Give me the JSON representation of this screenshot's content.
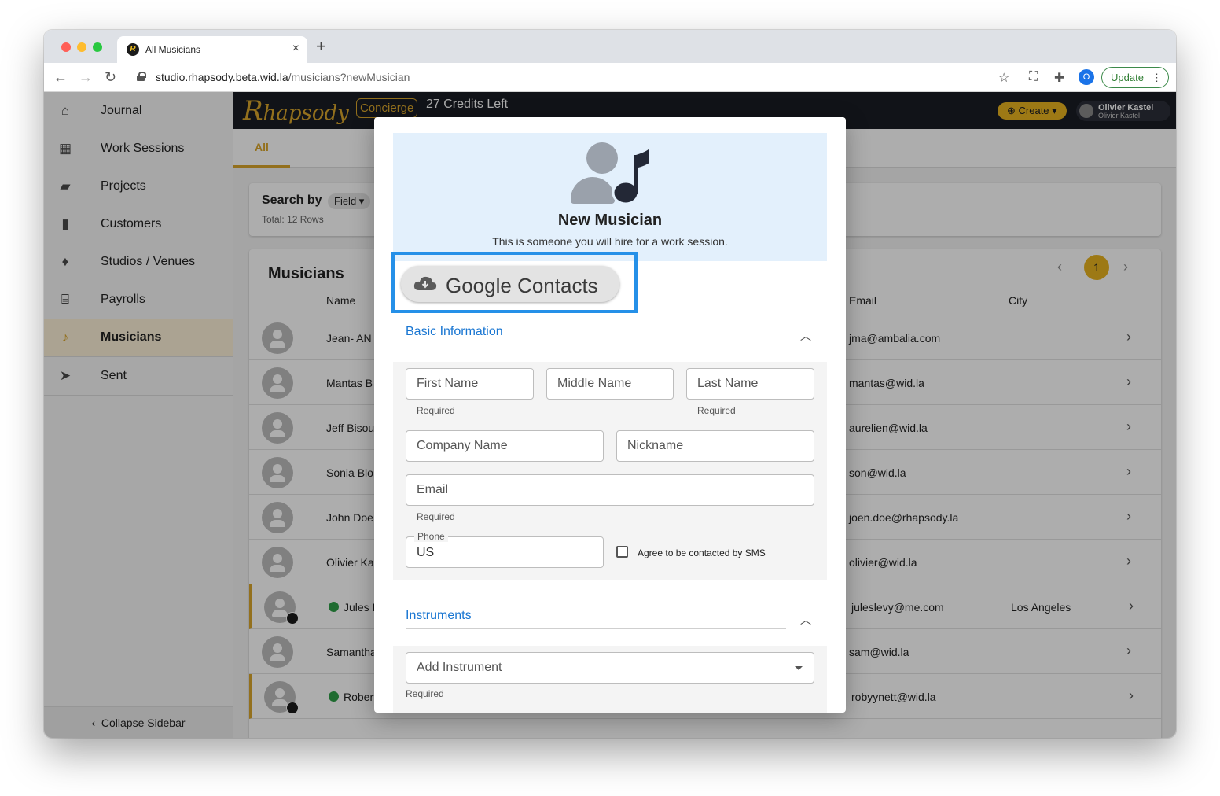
{
  "browser": {
    "tab_title": "All Musicians",
    "url_host": "studio.rhapsody.beta.wid.la",
    "url_path": "/musicians?newMusician",
    "profile_initial": "O",
    "update_label": "Update"
  },
  "sidebar": {
    "items": [
      {
        "label": "Journal",
        "icon": "home-icon"
      },
      {
        "label": "Work Sessions",
        "icon": "calendar-icon"
      },
      {
        "label": "Projects",
        "icon": "folder-icon"
      },
      {
        "label": "Customers",
        "icon": "building-icon"
      },
      {
        "label": "Studios / Venues",
        "icon": "microphone-icon"
      },
      {
        "label": "Payrolls",
        "icon": "bank-icon"
      },
      {
        "label": "Musicians",
        "icon": "musician-icon",
        "active": true
      },
      {
        "label": "Sent",
        "icon": "paper-plane-icon"
      }
    ],
    "collapse_label": "Collapse Sidebar"
  },
  "appbar": {
    "logo": "hapsody",
    "concierge": "Concierge",
    "credits": "27 Credits Left",
    "create_label": "Create",
    "user_name": "Olivier Kastel",
    "user_sub": "Olivier Kastel"
  },
  "tabs": {
    "all": "All"
  },
  "search": {
    "title": "Search by",
    "field_chip": "Field",
    "total": "Total: 12 Rows"
  },
  "table": {
    "title": "Musicians",
    "page": "1",
    "columns": {
      "name": "Name",
      "email": "Email",
      "city": "City"
    },
    "rows": [
      {
        "name": "Jean- AN",
        "email": "jma@ambalia.com",
        "city": "",
        "verified": false
      },
      {
        "name": "Mantas B",
        "email": "mantas@wid.la",
        "city": "",
        "verified": false
      },
      {
        "name": "Jeff Bisou",
        "email": "aurelien@wid.la",
        "city": "",
        "verified": false
      },
      {
        "name": "Sonia Blo",
        "email": "son@wid.la",
        "city": "",
        "verified": false
      },
      {
        "name": "John Doe",
        "email": "joen.doe@rhapsody.la",
        "city": "",
        "verified": false
      },
      {
        "name": "Olivier Ka",
        "email": "olivier@wid.la",
        "city": "",
        "verified": false
      },
      {
        "name": "Jules L",
        "email": "juleslevy@me.com",
        "city": "Los Angeles",
        "verified": true
      },
      {
        "name": "Samantha",
        "email": "sam@wid.la",
        "city": "",
        "verified": false
      },
      {
        "name": "Robert",
        "email": "robyynett@wid.la",
        "city": "",
        "verified": true
      }
    ]
  },
  "modal": {
    "title": "New Musician",
    "subtitle": "This is someone you will hire for a work session.",
    "google_label": "Google Contacts",
    "basic_title": "Basic Information",
    "first_name": "First Name",
    "middle_name": "Middle Name",
    "last_name": "Last Name",
    "required": "Required",
    "company": "Company Name",
    "nickname": "Nickname",
    "email": "Email",
    "phone_label": "Phone",
    "phone_value": "US",
    "sms_label": "Agree to be contacted by SMS",
    "instruments_title": "Instruments",
    "add_instrument": "Add Instrument"
  },
  "colors": {
    "accent": "#d9a52b",
    "link": "#1976d2",
    "highlight": "#2590e8"
  }
}
